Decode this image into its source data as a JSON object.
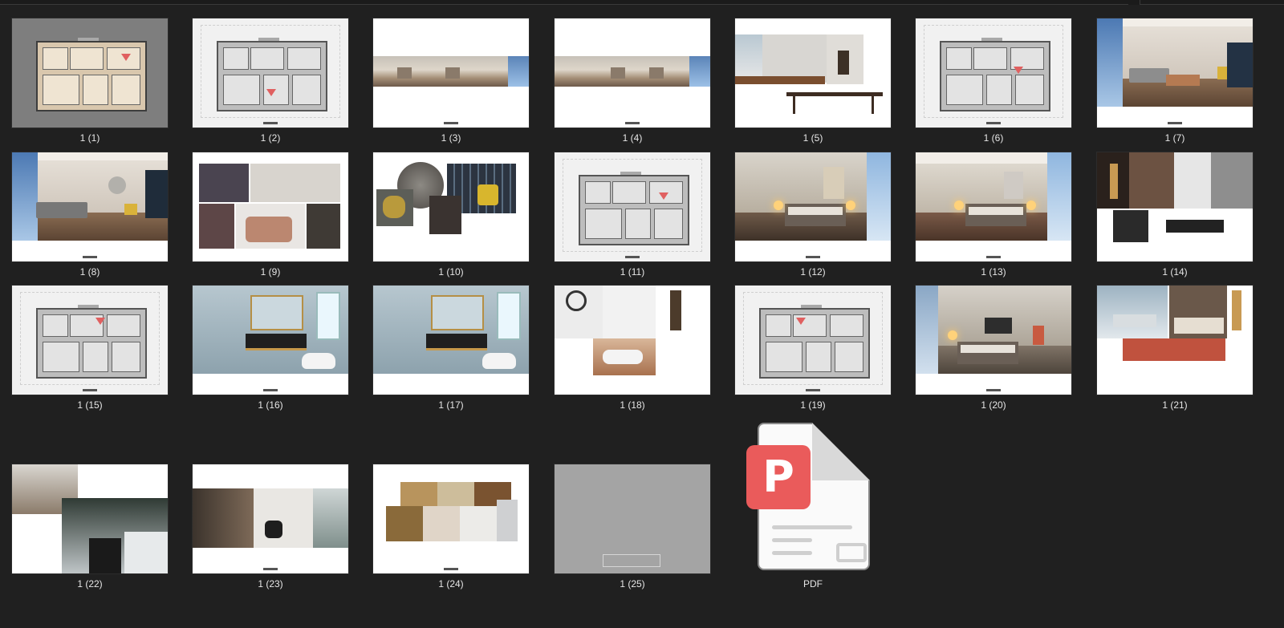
{
  "files": [
    {
      "name": "1 (1)",
      "kind": "floorplan-color"
    },
    {
      "name": "1 (2)",
      "kind": "floorplan"
    },
    {
      "name": "1 (3)",
      "kind": "panorama"
    },
    {
      "name": "1 (4)",
      "kind": "panorama"
    },
    {
      "name": "1 (5)",
      "kind": "collage-table"
    },
    {
      "name": "1 (6)",
      "kind": "floorplan"
    },
    {
      "name": "1 (7)",
      "kind": "living-render"
    },
    {
      "name": "1 (8)",
      "kind": "living-render"
    },
    {
      "name": "1 (9)",
      "kind": "collage-furniture"
    },
    {
      "name": "1 (10)",
      "kind": "collage-materials"
    },
    {
      "name": "1 (11)",
      "kind": "floorplan"
    },
    {
      "name": "1 (12)",
      "kind": "bedroom-render"
    },
    {
      "name": "1 (13)",
      "kind": "bedroom-render"
    },
    {
      "name": "1 (14)",
      "kind": "collage-bedroom"
    },
    {
      "name": "1 (15)",
      "kind": "floorplan"
    },
    {
      "name": "1 (16)",
      "kind": "bathroom-render"
    },
    {
      "name": "1 (17)",
      "kind": "bathroom-render"
    },
    {
      "name": "1 (18)",
      "kind": "collage-bath"
    },
    {
      "name": "1 (19)",
      "kind": "floorplan"
    },
    {
      "name": "1 (20)",
      "kind": "bedroom-render-2"
    },
    {
      "name": "1 (21)",
      "kind": "collage-bedroom-2"
    },
    {
      "name": "1 (22)",
      "kind": "kitchen"
    },
    {
      "name": "1 (23)",
      "kind": "closet"
    },
    {
      "name": "1 (24)",
      "kind": "material-samples"
    },
    {
      "name": "1 (25)",
      "kind": "gray-page"
    },
    {
      "name": "PDF",
      "kind": "pdf-file-icon"
    }
  ],
  "colors": {
    "background": "#202020",
    "caption": "#e6e6e6",
    "pdf_badge": "#ea5b5b"
  },
  "pdf_badge_glyph": "P"
}
